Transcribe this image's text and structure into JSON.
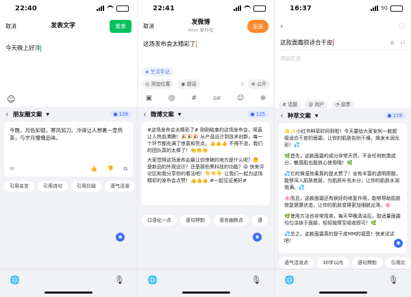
{
  "panels": [
    {
      "status": {
        "time": "22:40"
      },
      "nav": {
        "cancel": "取消",
        "title": "发表文字",
        "action": "发表"
      },
      "editor": {
        "text": "今天晚上好冷"
      },
      "ai": {
        "title": "朋友圈文案",
        "badge": "128",
        "card_text": "今晚，月色如银，寒风如刀。冷得让人想裹一壶热茶，与岁月慢慢品味。",
        "pills": [
          "引用名言",
          "引用诗句",
          "引用比喻",
          "语气活泼"
        ]
      },
      "icons": {
        "emoji": "smile-icon"
      }
    },
    {
      "status": {
        "time": "22:41"
      },
      "nav": {
        "cancel": "取消",
        "title": "发微博",
        "subtitle": "Alter 聊科技",
        "action": "发送"
      },
      "editor": {
        "text": "这场发布会太精彩了"
      },
      "meta": {
        "topic": "生活手记",
        "location": "添加位置",
        "visibility": "超话",
        "count": "0",
        "public": "公开"
      },
      "ai": {
        "title": "微博文案",
        "badge": "125",
        "card_p1": "#这场发布会太精彩了# 刚刚结束的这场发布会，简直让人热血沸腾！🎉🎉🎉 从产品设计到技术创新，每一个环节都充满了惊喜和亮点。👍👍👍 不得不说，我们的团队真的太棒了！👏👏👏",
        "card_p2": "大家觉得这场发布会最让你惊艳的地方是什么呢？🤔 是新品的外观设计？还是那些黑科技的功能？😝 快来评论区和我分享你的看法吧！👇👇👇 让我们一起为这场精彩的发布会点赞！👍👍👍 #一起见证美好#",
        "pills": [
          "口语化一点",
          "语句押韵",
          "语言幽默点",
          "语"
        ]
      }
    },
    {
      "status": {
        "time": "16:37",
        "network": "5G"
      },
      "editor": {
        "text": "这款面霜很适合干皮",
        "count": "11",
        "placeholder": "添加正文"
      },
      "tags": {
        "topic": "# 话题",
        "user": "@ 用户",
        "vote": "投票"
      },
      "ai": {
        "title": "种草文案",
        "badge": "119",
        "card_p1": "🌟✨小红书种草时间到啦！今天要给大家安利一款超级适合干皮的面霜，让你的肌肤告别干燥，焕发水润光彩！💦",
        "card_p2": "🌿首先，这款面霜的成分非常天然，不含任何刺激成分，敏感肌也能放心使用哦！🌿",
        "card_p3": "💦它的保湿效果真的是太赞了！含有丰富的透明质酸，能够深入肌肤底层，为肌肤补充水分，让你的肌肤水润饱满。💦",
        "card_p4": "🌸而且，这款面霜还有很好的修复作用，能够帮助肌肤恢复健康状态，让你的肌肤变得更加细腻光滑。🌸",
        "card_p5": "🌿使用方法也非常简单，每天早晚清洁后，取适量面霜均匀涂抹于面部，轻轻按摩至吸收即可！🌿",
        "card_p6": "💦总之，这款面霜真的是干皮MM的福音！快来试试吧！",
        "pills": [
          "语气活泼点",
          "30字以内",
          "语句押韵",
          "引用比"
        ]
      }
    }
  ]
}
